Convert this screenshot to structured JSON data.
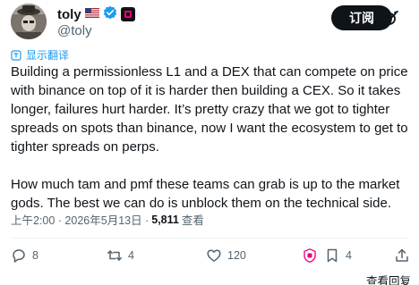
{
  "post": {
    "author": {
      "display_name": "toly",
      "handle": "@toly",
      "flag_icon": "us-flag-icon",
      "verified_icon": "verified-badge-icon",
      "affiliate_icon": "solana-badge-icon"
    },
    "follow_label": "订阅",
    "translate_label": "显示翻译",
    "body": [
      "Building a permissionless L1 and a DEX that can compete on price with binance on top of it is harder then building a CEX.  So it takes longer, failures hurt harder.  It’s pretty crazy that we got to tighter spreads on spots than binance, now I want the ecosystem to get to tighter spreads on perps.",
      "How much tam and pmf these teams can grab is up to the market gods. The best we can do is unblock them on the technical side."
    ],
    "timestamp": "上午2:00 · 2026年5月13日 · ",
    "views_count": "5,811",
    "views_label": "查看"
  },
  "actions": {
    "replies": "8",
    "reposts": "4",
    "likes": "120",
    "bookmarks": "4",
    "view_replies_label": "查看回复"
  },
  "colors": {
    "accent": "#1d9bf0",
    "text": "#0f1419",
    "muted": "#536471",
    "follow_bg": "#0f1419",
    "verified": "#1d9bf0",
    "brand_pink": "#e6007a"
  }
}
